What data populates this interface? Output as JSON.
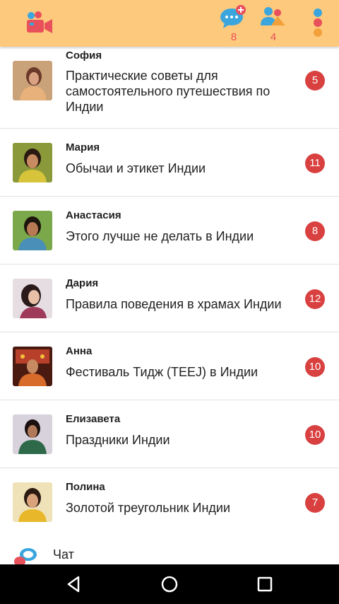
{
  "header": {
    "chat_count": "8",
    "friends_count": "4",
    "icons": [
      "video-call-icon",
      "chat-add-icon",
      "friends-icon",
      "overflow-menu-icon"
    ]
  },
  "rows": [
    {
      "name": "София",
      "title": "Практические советы для самостоятельного путешествия по Индии",
      "count": "5"
    },
    {
      "name": "Мария",
      "title": "Обычаи и этикет Индии",
      "count": "11"
    },
    {
      "name": "Анастасия",
      "title": "Этого лучше не делать в Индии",
      "count": "8"
    },
    {
      "name": "Дария",
      "title": "Правила поведения в храмах Индии",
      "count": "12"
    },
    {
      "name": "Анна",
      "title": "Фестиваль Тидж (TEEJ) в Индии",
      "count": "10"
    },
    {
      "name": "Елизавета",
      "title": "Праздники Индии",
      "count": "10"
    },
    {
      "name": "Полина",
      "title": "Золотой треугольник Индии",
      "count": "7"
    }
  ],
  "chat_item": {
    "label": "Чат"
  },
  "colors": {
    "header_bg": "#fdc97c",
    "badge": "#d94040",
    "accent_blue": "#3aa6dd",
    "accent_pink": "#e8505b"
  }
}
